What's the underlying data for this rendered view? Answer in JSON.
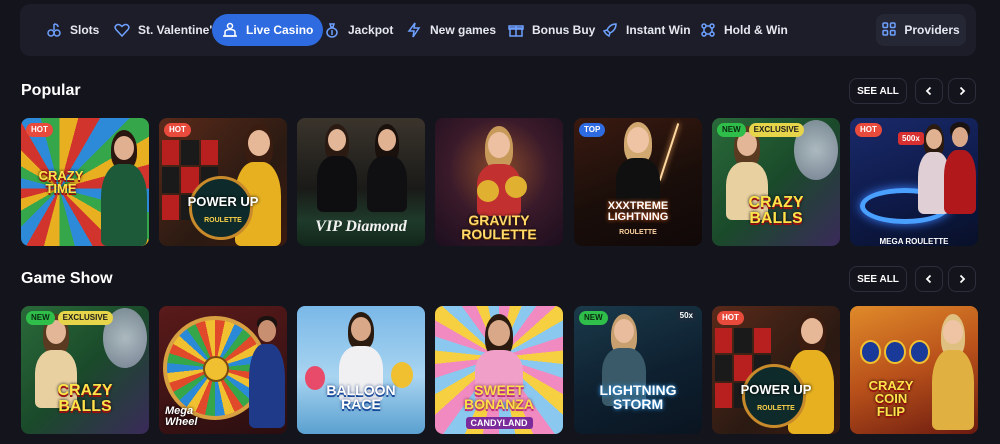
{
  "nav": {
    "items": [
      {
        "label": "Slots",
        "icon": "slots-icon",
        "active": false
      },
      {
        "label": "St. Valentine's",
        "icon": "heart-icon",
        "active": false
      },
      {
        "label": "Live Casino",
        "icon": "dealer-icon",
        "active": true
      },
      {
        "label": "Jackpot",
        "icon": "money-bag-icon",
        "active": false
      },
      {
        "label": "New games",
        "icon": "lightning-icon",
        "active": false
      },
      {
        "label": "Bonus Buy",
        "icon": "gift-icon",
        "active": false
      },
      {
        "label": "Instant Win",
        "icon": "rocket-icon",
        "active": false
      },
      {
        "label": "Hold & Win",
        "icon": "hold-win-icon",
        "active": false
      }
    ],
    "providers_label": "Providers",
    "accent": "#2f6be0"
  },
  "sections": [
    {
      "title": "Popular",
      "see_all": "SEE ALL",
      "games": [
        {
          "name": "CRAZY TIME",
          "badges": [
            "HOT"
          ]
        },
        {
          "name": "POWER UP",
          "subtitle": "ROULETTE",
          "badges": [
            "HOT"
          ]
        },
        {
          "name": "VIP Diamond",
          "badges": []
        },
        {
          "name": "GRAVITY ROULETTE",
          "badges": []
        },
        {
          "name": "XXXTREME LIGHTNING",
          "subtitle": "ROULETTE",
          "badges": [
            "TOP"
          ]
        },
        {
          "name": "CRAZY BALLS",
          "badges": [
            "NEW",
            "EXCLUSIVE"
          ]
        },
        {
          "name": "MEGA ROULETTE",
          "extra": "500x",
          "badges": [
            "HOT"
          ]
        }
      ]
    },
    {
      "title": "Game Show",
      "see_all": "SEE ALL",
      "games": [
        {
          "name": "CRAZY BALLS",
          "badges": [
            "NEW",
            "EXCLUSIVE"
          ]
        },
        {
          "name": "Mega Wheel",
          "badges": []
        },
        {
          "name": "BALLOON RACE",
          "badges": []
        },
        {
          "name": "SWEET BONANZA",
          "subtitle": "CANDYLAND",
          "badges": []
        },
        {
          "name": "LIGHTNING STORM",
          "extra": "50x",
          "badges": [
            "NEW"
          ]
        },
        {
          "name": "POWER UP",
          "subtitle": "ROULETTE",
          "badges": [
            "HOT"
          ]
        },
        {
          "name": "CRAZY COIN FLIP",
          "badges": []
        }
      ]
    }
  ],
  "colors": {
    "hot": "#e84a3c",
    "top": "#2f6be0",
    "new": "#2fbe49",
    "exclusive": "#e6d44a"
  }
}
